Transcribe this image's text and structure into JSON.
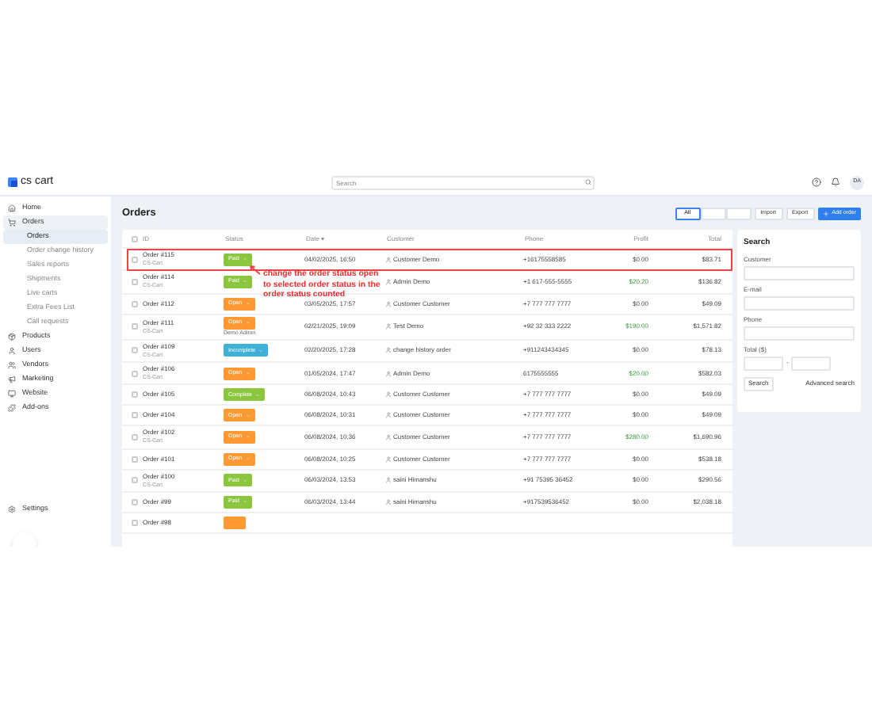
{
  "brand": "cs cart",
  "search": {
    "placeholder": "Search"
  },
  "avatar": "DA",
  "sidebar": {
    "items": [
      {
        "label": "Home",
        "expanded": false
      },
      {
        "label": "Orders",
        "expanded": true,
        "children": [
          {
            "label": "Orders",
            "selected": true
          },
          {
            "label": "Order change history",
            "selected": false
          },
          {
            "label": "Sales reports",
            "selected": false
          },
          {
            "label": "Shipments",
            "selected": false
          },
          {
            "label": "Live carts",
            "selected": false
          },
          {
            "label": "Extra Fees List",
            "selected": false
          },
          {
            "label": "Call requests",
            "selected": false
          }
        ]
      },
      {
        "label": "Products",
        "expanded": false
      },
      {
        "label": "Users",
        "expanded": false
      },
      {
        "label": "Vendors",
        "expanded": false
      },
      {
        "label": "Marketing",
        "expanded": false
      },
      {
        "label": "Website",
        "expanded": false
      },
      {
        "label": "Add-ons",
        "expanded": false
      }
    ],
    "settings": "Settings"
  },
  "page_title": "Orders",
  "toolbar": {
    "views": [
      {
        "label": "All",
        "selected": true
      },
      {
        "selected": false
      },
      {
        "selected": false
      }
    ],
    "buttons": [
      "Import",
      "Export"
    ],
    "primary": "Add order"
  },
  "table": {
    "all_checked": false,
    "columns": [
      "ID",
      "Status",
      "Date ▾",
      "Customer",
      "Phone",
      "Profit",
      "Total"
    ],
    "rows": [
      {
        "id": "Order #115",
        "source": "CS-Cart",
        "status": "Paid",
        "color": "#8cc63f",
        "date": "04/02/2025, 16:50",
        "customer": "Customer Demo",
        "phone": "+16175558585",
        "profit": "$0.00",
        "profit_positive": false,
        "total": "$83.71"
      },
      {
        "id": "Order #114",
        "source": "CS-Cart",
        "status": "Paid",
        "color": "#8cc63f",
        "customer": "Admin Demo",
        "phone": "+1 617-555-5555",
        "profit": "$20.20",
        "profit_positive": true,
        "total": "$136.82"
      },
      {
        "id": "Order #112",
        "status": "Open",
        "color": "#ff9933",
        "date": "03/05/2025, 17:57",
        "customer": "Customer Customer",
        "phone": "+7 777 777 7777",
        "profit": "$0.00",
        "profit_positive": false,
        "total": "$49.09"
      },
      {
        "id": "Order #111",
        "source": "CS-Cart",
        "status": "Open",
        "color": "#ff9933",
        "note": "Demo Admin",
        "date": "02/21/2025, 19:09",
        "customer": "Test Demo",
        "phone": "+92 32 333 2222",
        "profit": "$190.00",
        "profit_positive": true,
        "total": "$1,571.82"
      },
      {
        "id": "Order #109",
        "source": "CS-Cart",
        "status": "Incomplete",
        "color": "#3fb1d6",
        "date": "02/20/2025, 17:28",
        "customer": "change history order",
        "phone": "+911243434345",
        "profit": "$0.00",
        "profit_positive": false,
        "total": "$78.13"
      },
      {
        "id": "Order #106",
        "source": "CS-Cart",
        "status": "Open",
        "color": "#ff9933",
        "date": "01/05/2024, 17:47",
        "customer": "Admin Demo",
        "phone": "6175555555",
        "profit": "$20.00",
        "profit_positive": true,
        "total": "$582.03"
      },
      {
        "id": "Order #105",
        "status": "Complete",
        "color": "#8cc63f",
        "date": "06/08/2024, 10:43",
        "customer": "Customer Customer",
        "phone": "+7 777 777 7777",
        "profit": "$0.00",
        "profit_positive": false,
        "total": "$49.09"
      },
      {
        "id": "Order #104",
        "status": "Open",
        "color": "#ff9933",
        "date": "06/08/2024, 10:31",
        "customer": "Customer Customer",
        "phone": "+7 777 777 7777",
        "profit": "$0.00",
        "profit_positive": false,
        "total": "$49.09"
      },
      {
        "id": "Order #102",
        "source": "CS-Cart",
        "status": "Open",
        "color": "#ff9933",
        "date": "06/08/2024, 10:36",
        "customer": "Customer Customer",
        "phone": "+7 777 777 7777",
        "profit": "$280.00",
        "profit_positive": true,
        "total": "$1,690.96"
      },
      {
        "id": "Order #101",
        "status": "Open",
        "color": "#ff9933",
        "date": "06/08/2024, 10:25",
        "customer": "Customer Customer",
        "phone": "+7 777 777 7777",
        "profit": "$0.00",
        "profit_positive": false,
        "total": "$538.18"
      },
      {
        "id": "Order #100",
        "source": "CS-Cart",
        "status": "Paid",
        "color": "#8cc63f",
        "date": "06/03/2024, 13:53",
        "customer": "saini Himanshu",
        "phone": "+91 75395 36452",
        "profit": "$0.00",
        "profit_positive": false,
        "total": "$290.56"
      },
      {
        "id": "Order #99",
        "status": "Paid",
        "color": "#8cc63f",
        "date": "06/03/2024, 13:44",
        "customer": "saini Himanshu",
        "phone": "+917539536452",
        "profit": "$0.00",
        "profit_positive": false,
        "total": "$2,038.18"
      },
      {
        "id": "Order #98",
        "color": "#ff9933"
      }
    ]
  },
  "search_panel": {
    "title": "Search",
    "fields": [
      "Customer",
      "E-mail",
      "Phone"
    ],
    "total_label": "Total ($)",
    "range_sep": "-",
    "button": "Search",
    "link": "Advanced search"
  },
  "annotation": "change the order status open to selected order status in the order status counted"
}
